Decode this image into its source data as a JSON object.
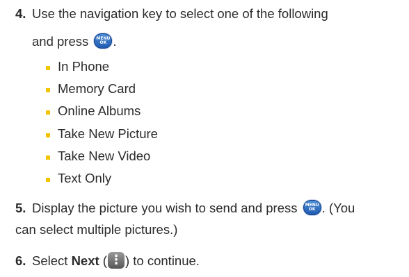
{
  "step4": {
    "number": "4.",
    "line1": "Use the navigation key to select one of the following",
    "line2_before": "and press",
    "line2_after": ".",
    "options": [
      "In Phone",
      "Memory Card",
      "Online Albums",
      "Take New Picture",
      "Take New Video",
      "Text Only"
    ]
  },
  "step5": {
    "number": "5.",
    "line1_before": "Display the picture you wish to send and press",
    "line1_after": ". (You",
    "line2": "can select multiple pictures.)"
  },
  "step6": {
    "number": "6.",
    "before": "Select",
    "bold": "Next",
    "paren_open": " (",
    "after": ") to continue."
  },
  "keys": {
    "menu_ok_top": "MENU",
    "menu_ok_bottom": "OK",
    "next_glyph": "⋮"
  },
  "colors": {
    "bullet": "#f5c400",
    "menu_key": "#2f6fc6",
    "next_key": "#777777"
  }
}
